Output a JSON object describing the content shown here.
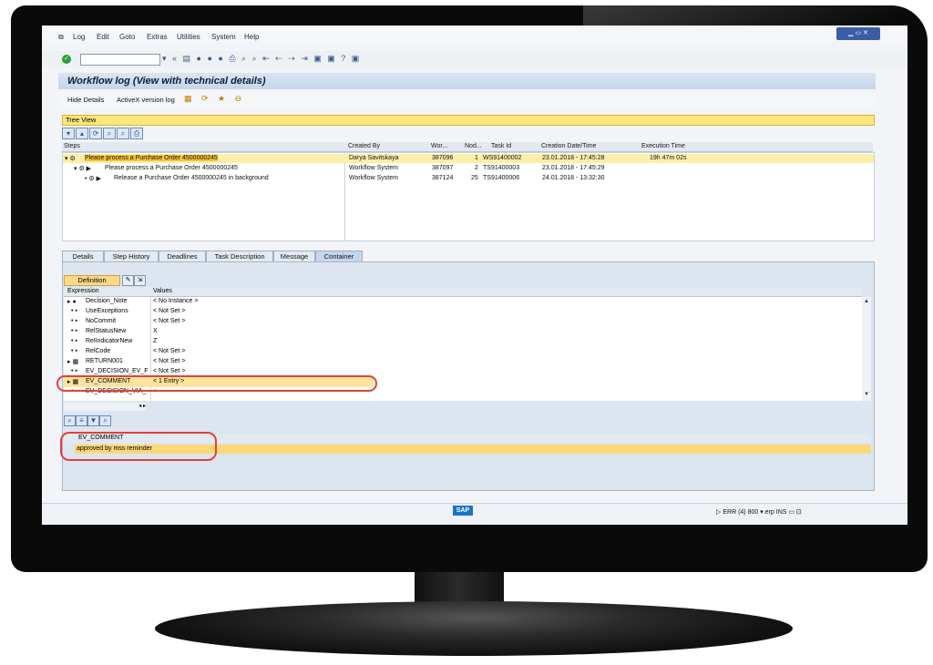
{
  "menu": [
    "Log",
    "Edit",
    "Goto",
    "Extras",
    "Utilities",
    "System",
    "Help"
  ],
  "window": {
    "title": "Workflow log (View with technical details)"
  },
  "app_toolbar": {
    "hide_details": "Hide Details",
    "activex": "ActiveX version log"
  },
  "tree_view": {
    "label": "Tree View"
  },
  "steps_grid": {
    "headers": [
      "Steps",
      "Created By",
      "Wor...",
      "Nod...",
      "Task Id",
      "Creation Date/Time",
      "Execution Time"
    ],
    "rows": [
      {
        "step": "Please process a Purchase Order 4500000245",
        "created_by": "Darya Savitskaya",
        "wor": "387096",
        "nod": "1",
        "task_id": "WS91400002",
        "created": "23.01.2018 - 17:45:28",
        "exec": "19h 47m 02s"
      },
      {
        "step": "Please process a Purchase Order 4500000245",
        "created_by": "Workflow System",
        "wor": "387097",
        "nod": "2",
        "task_id": "TS91400003",
        "created": "23.01.2018 - 17:45:29",
        "exec": ""
      },
      {
        "step": "Release a Purchase Order 4500000245 in background",
        "created_by": "Workflow System",
        "wor": "387124",
        "nod": "25",
        "task_id": "TS91400006",
        "created": "24.01.2018 - 13:32:30",
        "exec": ""
      }
    ]
  },
  "tabs": [
    "Details",
    "Step History",
    "Deadlines",
    "Task Description",
    "Message",
    "Container"
  ],
  "container": {
    "definition": "Definition",
    "headers": [
      "Expression",
      "Values"
    ],
    "rows": [
      {
        "expr": "Decision_Note",
        "value": "< No Instance >"
      },
      {
        "expr": "UseExceptions",
        "value": "< Not Set >"
      },
      {
        "expr": "NoCommit",
        "value": "< Not Set >"
      },
      {
        "expr": "RelStatusNew",
        "value": "X"
      },
      {
        "expr": "RelIndicatorNew",
        "value": "Z"
      },
      {
        "expr": "RelCode",
        "value": "< Not Set >"
      },
      {
        "expr": "RETURN001",
        "value": "< Not Set >"
      },
      {
        "expr": "EV_DECISION_EV_F",
        "value": "< Not Set >"
      },
      {
        "expr": "EV_COMMENT",
        "value": "< 1 Entry >"
      },
      {
        "expr": "EV_DECISION_VIA_",
        "value": "+"
      }
    ]
  },
  "ev_comment": {
    "name": "EV_COMMENT",
    "value": "approved by mss reminder"
  },
  "status": {
    "logo": "SAP",
    "system": "ERR (4) 800",
    "server": "erp",
    "mode": "INS"
  }
}
